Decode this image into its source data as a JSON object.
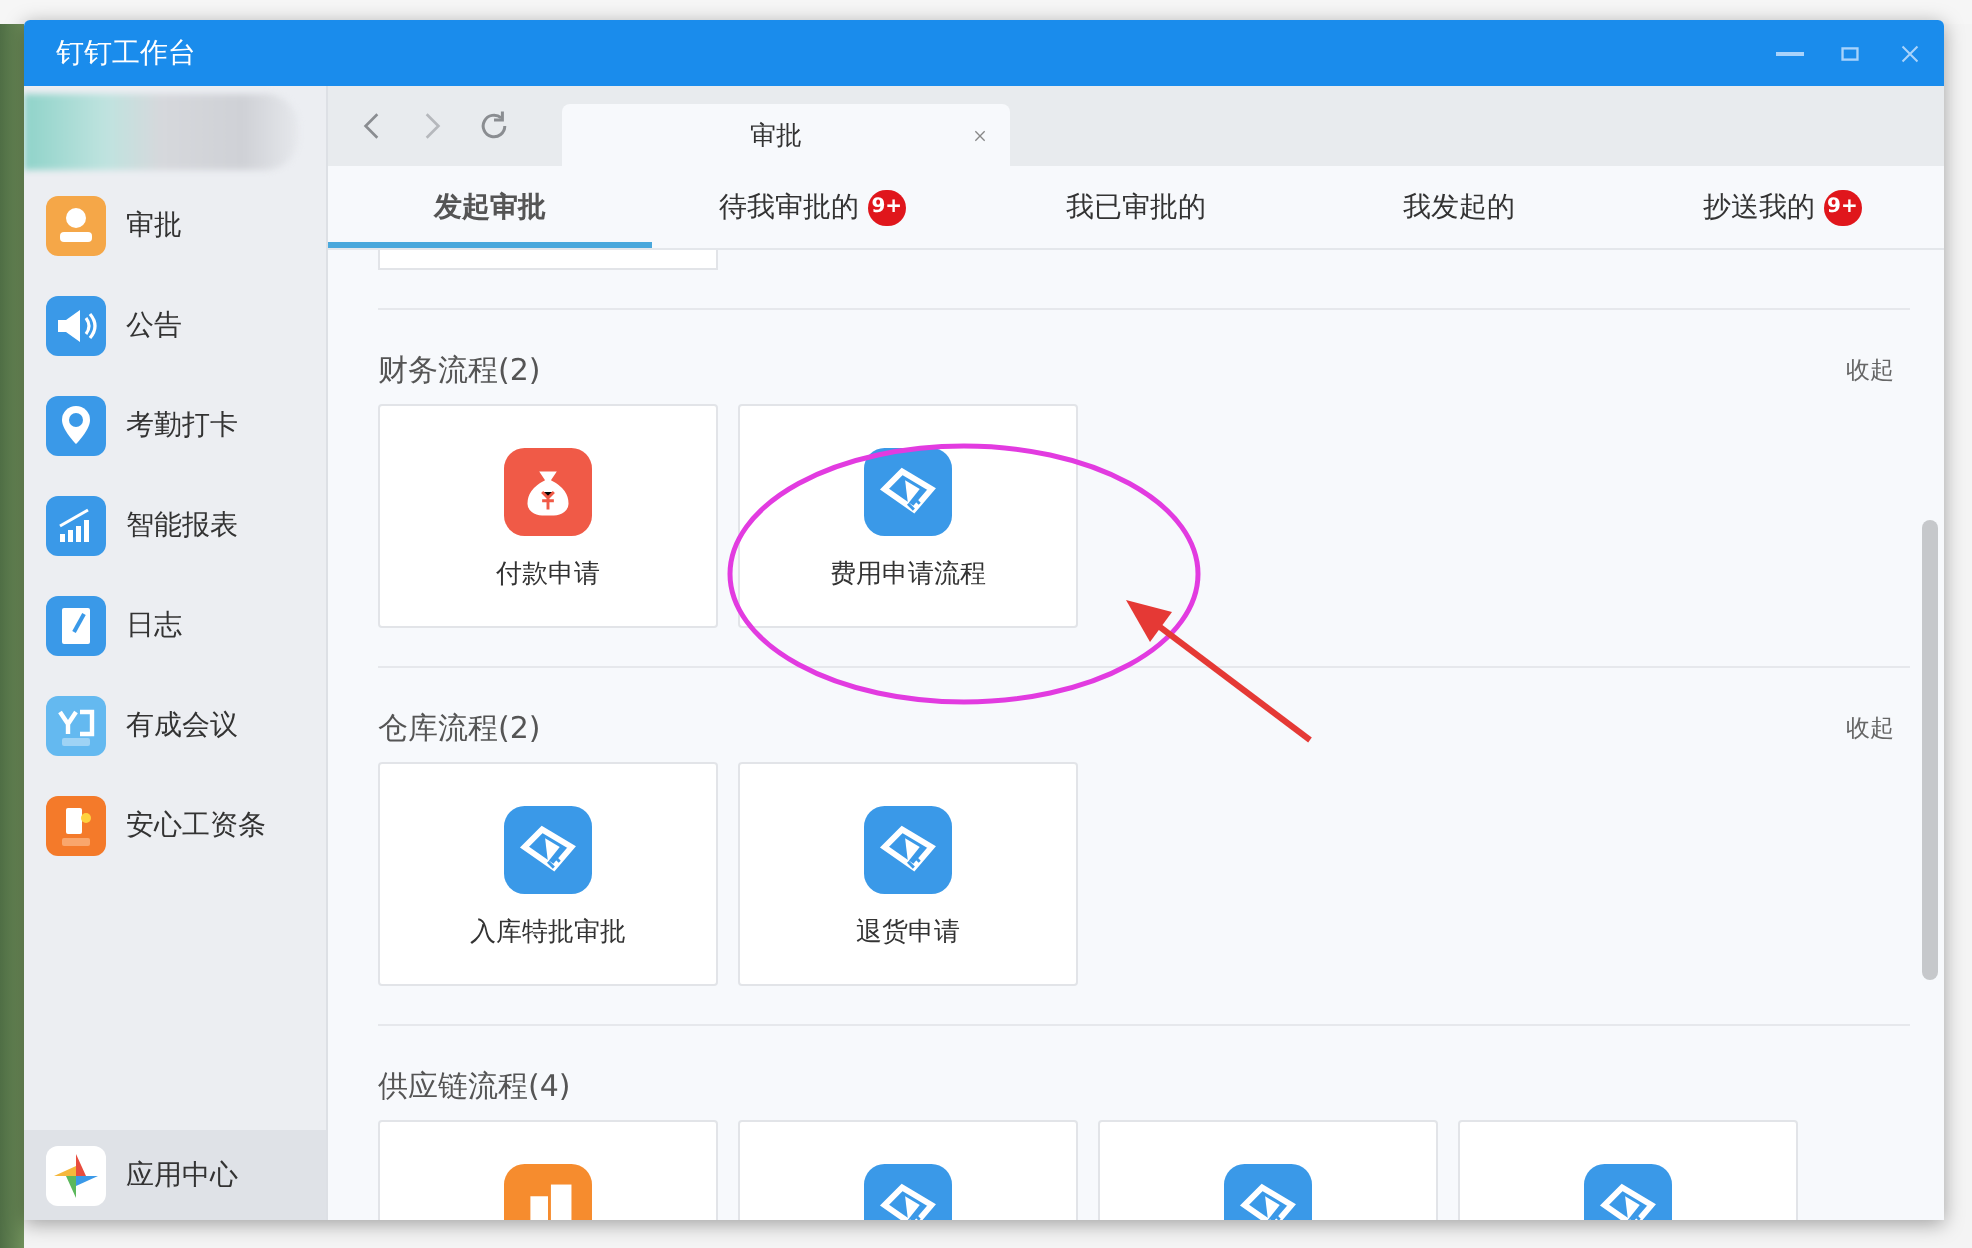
{
  "window": {
    "title": "钉钉工作台"
  },
  "sidebar": {
    "items": [
      {
        "label": "审批",
        "selected": false
      },
      {
        "label": "公告",
        "selected": false
      },
      {
        "label": "考勤打卡",
        "selected": false
      },
      {
        "label": "智能报表",
        "selected": false
      },
      {
        "label": "日志",
        "selected": false
      },
      {
        "label": "有成会议",
        "selected": false
      },
      {
        "label": "安心工资条",
        "selected": false
      }
    ],
    "footer_item": {
      "label": "应用中心",
      "selected": true
    }
  },
  "browser_tab": {
    "title": "审批"
  },
  "tabs": [
    {
      "label": "发起审批",
      "selected": true
    },
    {
      "label": "待我审批的",
      "badge": "9+",
      "selected": false
    },
    {
      "label": "我已审批的",
      "selected": false
    },
    {
      "label": "我发起的",
      "selected": false
    },
    {
      "label": "抄送我的",
      "badge": "9+",
      "selected": false
    }
  ],
  "sections": [
    {
      "title": "财务流程(2)",
      "collapse": "收起",
      "cards": [
        {
          "kind": "money",
          "label": "付款申请"
        },
        {
          "kind": "hand",
          "label": "费用申请流程"
        }
      ]
    },
    {
      "title": "仓库流程(2)",
      "collapse": "收起",
      "cards": [
        {
          "kind": "hand",
          "label": "入库特批审批"
        },
        {
          "kind": "hand",
          "label": "退货申请"
        }
      ]
    },
    {
      "title": "供应链流程(4)",
      "cards": [
        {
          "kind": "doc"
        },
        {
          "kind": "hand"
        },
        {
          "kind": "hand"
        },
        {
          "kind": "hand"
        }
      ]
    }
  ],
  "annotations": [
    {
      "kind": "ellipse"
    },
    {
      "kind": "arrow"
    }
  ]
}
